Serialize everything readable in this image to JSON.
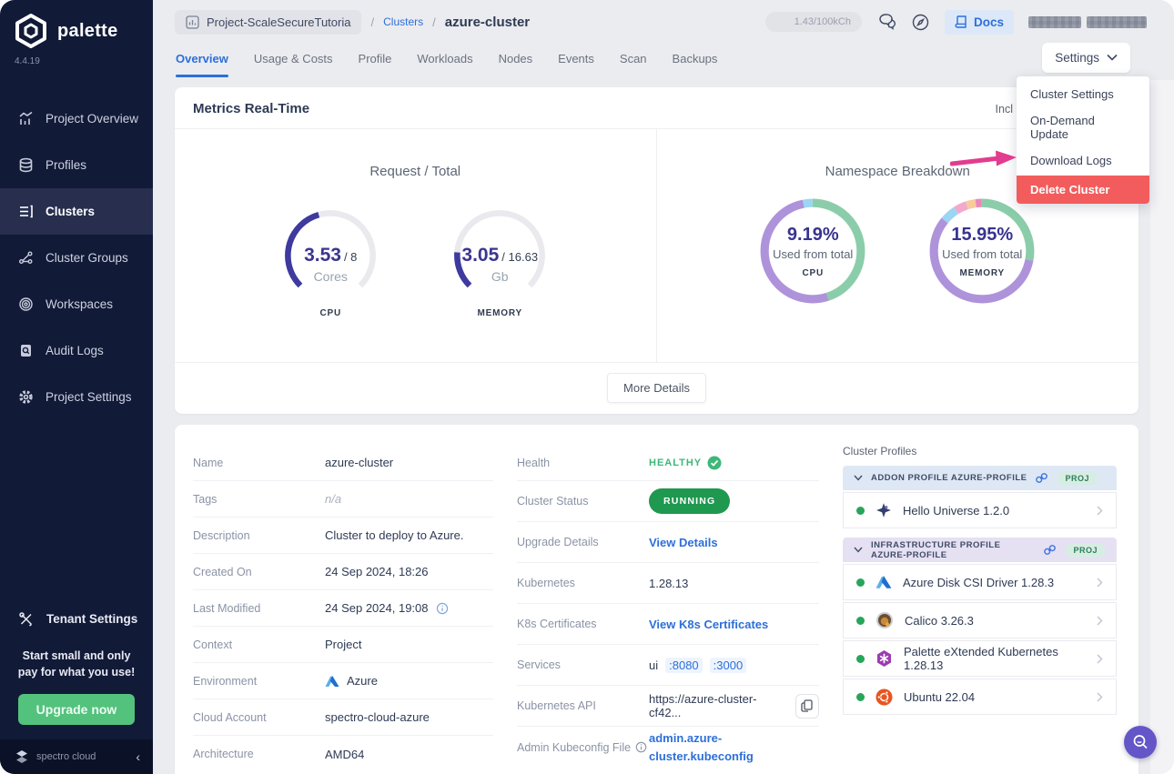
{
  "brand": {
    "name": "palette",
    "version": "4.4.19",
    "footer": "spectro cloud"
  },
  "sidebar": {
    "items": [
      {
        "label": "Project Overview"
      },
      {
        "label": "Profiles"
      },
      {
        "label": "Clusters"
      },
      {
        "label": "Cluster Groups"
      },
      {
        "label": "Workspaces"
      },
      {
        "label": "Audit Logs"
      },
      {
        "label": "Project Settings"
      }
    ],
    "tenant_settings": "Tenant Settings",
    "promo_text": "Start small and only pay for what you use!",
    "upgrade_button": "Upgrade now"
  },
  "header": {
    "breadcrumb": {
      "project": "Project-ScaleSecureTutoria",
      "sep1": "/",
      "section": "Clusters",
      "sep2": "/",
      "current": "azure-cluster"
    },
    "usage_badge": "1.43/100kCh",
    "docs_label": "Docs",
    "settings_button": "Settings",
    "tabs": [
      {
        "label": "Overview"
      },
      {
        "label": "Usage & Costs"
      },
      {
        "label": "Profile"
      },
      {
        "label": "Workloads"
      },
      {
        "label": "Nodes"
      },
      {
        "label": "Events"
      },
      {
        "label": "Scan"
      },
      {
        "label": "Backups"
      }
    ]
  },
  "settings_menu": {
    "items": [
      {
        "label": "Cluster Settings"
      },
      {
        "label": "On-Demand Update"
      },
      {
        "label": "Download Logs"
      },
      {
        "label": "Delete Cluster"
      }
    ]
  },
  "metrics": {
    "title": "Metrics Real-Time",
    "clipped_label": "Incl",
    "request_total": {
      "title": "Request / Total",
      "gauges": [
        {
          "value": "3.53",
          "total": "/ 8",
          "unit": "Cores",
          "label": "CPU",
          "fraction": 0.441
        },
        {
          "value": "3.05",
          "total": "/ 16.63",
          "unit": "Gb",
          "label": "MEMORY",
          "fraction": 0.183
        }
      ]
    },
    "namespace_breakdown": {
      "title": "Namespace Breakdown",
      "donuts": [
        {
          "percent": "9.19%",
          "caption": "Used from total",
          "label": "CPU"
        },
        {
          "percent": "15.95%",
          "caption": "Used from total",
          "label": "MEMORY"
        }
      ]
    },
    "more_details_button": "More Details"
  },
  "overview": {
    "left_rows": [
      {
        "label": "Name",
        "value": "azure-cluster"
      },
      {
        "label": "Tags",
        "value": "n/a"
      },
      {
        "label": "Description",
        "value": "Cluster to deploy to Azure."
      },
      {
        "label": "Created On",
        "value": "24 Sep 2024, 18:26"
      },
      {
        "label": "Last Modified",
        "value": "24 Sep 2024, 19:08"
      },
      {
        "label": "Context",
        "value": "Project"
      },
      {
        "label": "Environment",
        "value": "Azure"
      },
      {
        "label": "Cloud Account",
        "value": "spectro-cloud-azure"
      },
      {
        "label": "Architecture",
        "value": "AMD64"
      }
    ],
    "mid": {
      "health_label": "Health",
      "health_value": "HEALTHY",
      "status_label": "Cluster Status",
      "status_value": "RUNNING",
      "upgrade_label": "Upgrade Details",
      "upgrade_link": "View Details",
      "k8s_label": "Kubernetes",
      "k8s_value": "1.28.13",
      "certs_label": "K8s Certificates",
      "certs_link": "View K8s Certificates",
      "services_label": "Services",
      "services_prefix": "ui",
      "port1": ":8080",
      "port2": ":3000",
      "api_label": "Kubernetes API",
      "api_value": "https://azure-cluster-cf42...",
      "kubeconfig_label": "Admin Kubeconfig File",
      "kubeconfig_link": "admin.azure-cluster.kubeconfig"
    }
  },
  "profiles_panel": {
    "title": "Cluster Profiles",
    "groups": [
      {
        "header": "ADDON PROFILE AZURE-PROFILE",
        "badge": "PROJ",
        "items": [
          {
            "name": "Hello Universe 1.2.0"
          }
        ]
      },
      {
        "header": "INFRASTRUCTURE PROFILE AZURE-PROFILE",
        "badge": "PROJ",
        "items": [
          {
            "name": "Azure Disk CSI Driver 1.28.3"
          },
          {
            "name": "Calico 3.26.3"
          },
          {
            "name": "Palette eXtended Kubernetes 1.28.13"
          },
          {
            "name": "Ubuntu 22.04"
          }
        ]
      }
    ]
  },
  "colors": {
    "accent_blue": "#2D6FD9",
    "danger_red": "#F25C5C",
    "annotation_pink": "#E23C8F",
    "gauge_indigo": "#3E3A9E",
    "donut_purple": "#AE93DB",
    "donut_green": "#8BCDAA",
    "donut_blue": "#9AD6F2",
    "donut_pink": "#F3A8CE",
    "donut_peach": "#F7CB9C",
    "donut_magenta": "#EC87BC",
    "running_green": "#1F9850",
    "healthy_green": "#3CB878"
  }
}
